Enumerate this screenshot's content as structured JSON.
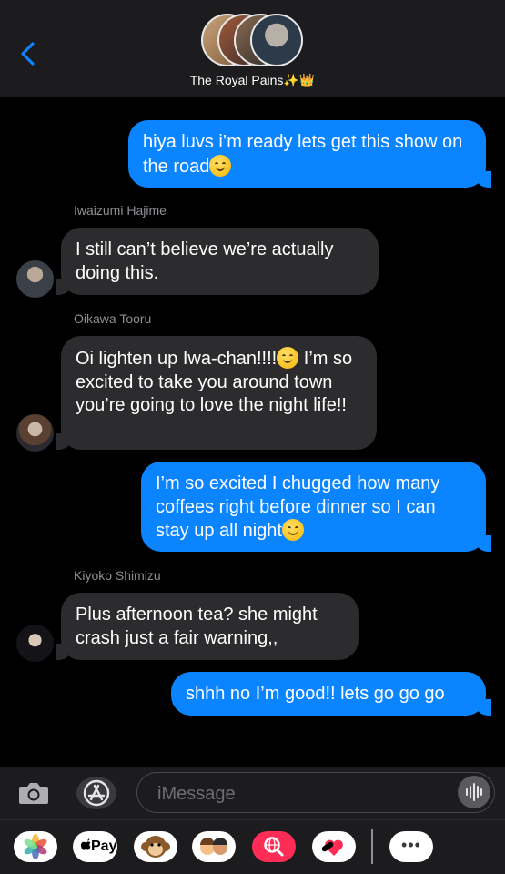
{
  "header": {
    "group_name": "The Royal Pains✨👑",
    "back_icon": "chevron-left-icon",
    "accent": "#0a84ff"
  },
  "messages": [
    {
      "direction": "outgoing",
      "text": "hiya luvs i’m ready lets get this show on the road",
      "emoji": "🥰"
    },
    {
      "direction": "incoming",
      "sender": "Iwaizumi Hajime",
      "text": "I still can’t believe we’re actually doing this."
    },
    {
      "direction": "incoming",
      "sender": "Oikawa Tooru",
      "text_a": "Oi lighten up Iwa-chan!!!!",
      "emoji": "😊",
      "text_b": " I’m so excited to take you around town you’re going to love the night life!!"
    },
    {
      "direction": "outgoing",
      "text": "I’m so excited I chugged how many coffees right before dinner so I can stay up all night",
      "emoji": "☺️"
    },
    {
      "direction": "incoming",
      "sender": "Kiyoko Shimizu",
      "text": "Plus afternoon tea? she might crash just a fair warning,,"
    },
    {
      "direction": "outgoing",
      "text": "shhh no I’m good!! lets go go go"
    }
  ],
  "composer": {
    "placeholder": "iMessage",
    "camera_icon": "camera-icon",
    "appstore_icon": "app-store-icon",
    "mic_icon": "audio-waveform-icon"
  },
  "drawer": {
    "apps": [
      "photos-icon",
      "apple-pay-icon",
      "monkey-animoji-icon",
      "memoji-icon",
      "web-search-icon",
      "digital-touch-icon",
      "more-icon"
    ],
    "pay_label": "Pay",
    "more_label": "•••"
  }
}
